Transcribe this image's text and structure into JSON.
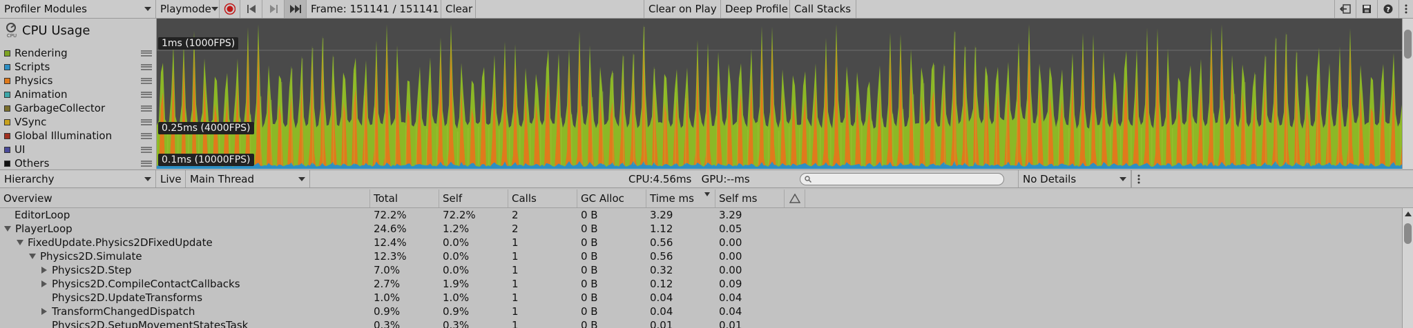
{
  "toolbar": {
    "modules_label": "Profiler Modules",
    "mode_label": "Playmode",
    "frame_label": "Frame: 151141 / 151141",
    "clear_label": "Clear",
    "clear_on_play_label": "Clear on Play",
    "deep_profile_label": "Deep Profile",
    "call_stacks_label": "Call Stacks"
  },
  "cpu_module": {
    "title": "CPU Usage",
    "icon_text": "CPU",
    "legend": [
      {
        "label": "Rendering",
        "color": "#7ea324"
      },
      {
        "label": "Scripts",
        "color": "#2d8fc4"
      },
      {
        "label": "Physics",
        "color": "#e07a1c"
      },
      {
        "label": "Animation",
        "color": "#3ea6a8"
      },
      {
        "label": "GarbageCollector",
        "color": "#7b6f2c"
      },
      {
        "label": "VSync",
        "color": "#c9a21d"
      },
      {
        "label": "Global Illumination",
        "color": "#a03020"
      },
      {
        "label": "UI",
        "color": "#4a4a9a"
      },
      {
        "label": "Others",
        "color": "#111111"
      }
    ]
  },
  "chart_data": {
    "type": "area",
    "title": "",
    "reference_lines": [
      "1ms (1000FPS)",
      "0.25ms (4000FPS)",
      "0.1ms (10000FPS)"
    ],
    "colors": {
      "rendering": "#8cb826",
      "physics": "#e07a1c",
      "scripts": "#2d8fc4",
      "background": "#4a4a4a"
    }
  },
  "hierarchy_bar": {
    "view_label": "Hierarchy",
    "live_label": "Live",
    "thread_label": "Main Thread",
    "cpu_gpu_label": "CPU:4.56ms   GPU:--ms",
    "search_placeholder": "",
    "details_label": "No Details"
  },
  "table": {
    "columns": [
      "Overview",
      "Total",
      "Self",
      "Calls",
      "GC Alloc",
      "Time ms",
      "Self ms"
    ],
    "rows": [
      {
        "name": "EditorLoop",
        "total": "72.2%",
        "self": "72.2%",
        "calls": "2",
        "gc": "0 B",
        "time": "3.29",
        "selfms": "3.29"
      },
      {
        "name": "PlayerLoop",
        "total": "24.6%",
        "self": "1.2%",
        "calls": "2",
        "gc": "0 B",
        "time": "1.12",
        "selfms": "0.05"
      },
      {
        "name": "FixedUpdate.Physics2DFixedUpdate",
        "total": "12.4%",
        "self": "0.0%",
        "calls": "1",
        "gc": "0 B",
        "time": "0.56",
        "selfms": "0.00"
      },
      {
        "name": "Physics2D.Simulate",
        "total": "12.3%",
        "self": "0.0%",
        "calls": "1",
        "gc": "0 B",
        "time": "0.56",
        "selfms": "0.00"
      },
      {
        "name": "Physics2D.Step",
        "total": "7.0%",
        "self": "0.0%",
        "calls": "1",
        "gc": "0 B",
        "time": "0.32",
        "selfms": "0.00"
      },
      {
        "name": "Physics2D.CompileContactCallbacks",
        "total": "2.7%",
        "self": "1.9%",
        "calls": "1",
        "gc": "0 B",
        "time": "0.12",
        "selfms": "0.09"
      },
      {
        "name": "Physics2D.UpdateTransforms",
        "total": "1.0%",
        "self": "1.0%",
        "calls": "1",
        "gc": "0 B",
        "time": "0.04",
        "selfms": "0.04"
      },
      {
        "name": "TransformChangedDispatch",
        "total": "0.9%",
        "self": "0.9%",
        "calls": "1",
        "gc": "0 B",
        "time": "0.04",
        "selfms": "0.04"
      },
      {
        "name": "Physics2D.SetupMovementStatesTask",
        "total": "0.3%",
        "self": "0.3%",
        "calls": "1",
        "gc": "0 B",
        "time": "0.01",
        "selfms": "0.01"
      }
    ]
  }
}
